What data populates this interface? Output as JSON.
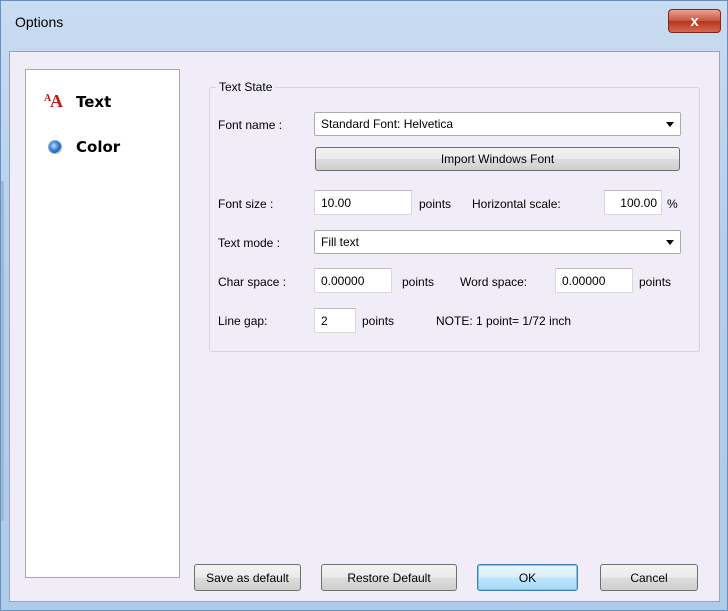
{
  "window": {
    "title": "Options",
    "close_label": "x"
  },
  "nav": {
    "items": [
      {
        "label": "Text",
        "icon": "font-aa-icon"
      },
      {
        "label": "Color",
        "icon": "radio-selected-icon"
      }
    ]
  },
  "text_state": {
    "group_label": "Text State",
    "font_name": {
      "label": "Font name :",
      "value": "Standard Font: Helvetica"
    },
    "import_button": "Import Windows Font",
    "font_size": {
      "label": "Font size :",
      "value": "10.00",
      "unit": "points"
    },
    "horizontal_scale": {
      "label": "Horizontal scale:",
      "value": "100.00",
      "unit": "%"
    },
    "text_mode": {
      "label": "Text mode :",
      "value": "Fill text"
    },
    "char_space": {
      "label": "Char space :",
      "value": "0.00000",
      "unit": "points"
    },
    "word_space": {
      "label": "Word space:",
      "value": "0.00000",
      "unit": "points"
    },
    "line_gap": {
      "label": "Line gap:",
      "value": "2",
      "unit": "points"
    },
    "note": "NOTE: 1 point= 1/72 inch"
  },
  "footer": {
    "save_default": "Save as default",
    "restore_default": "Restore Default",
    "ok": "OK",
    "cancel": "Cancel"
  },
  "colors": {
    "accent": "#c0181b",
    "client_bg": "#f1edf8"
  }
}
